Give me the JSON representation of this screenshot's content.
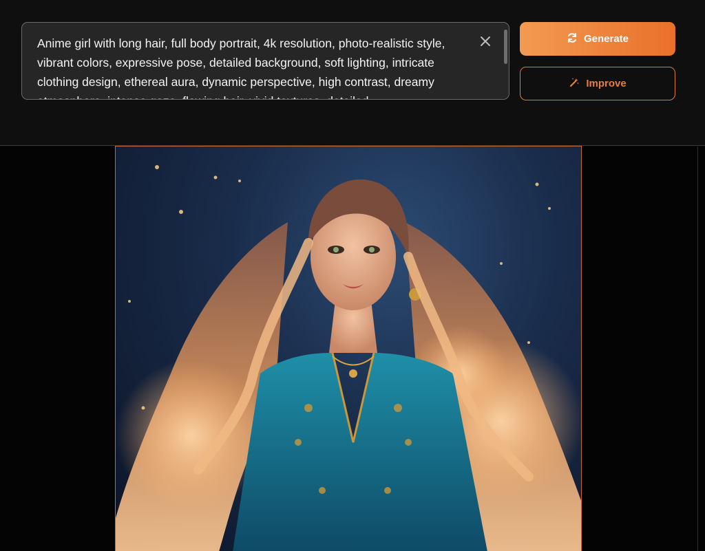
{
  "prompt": {
    "text": "Anime girl with long hair, full body portrait, 4k resolution, photo-realistic style, vibrant colors, expressive pose, detailed background, soft lighting, intricate clothing design, ethereal aura, dynamic perspective, high contrast, dreamy atmosphere, intense gaze, flowing hair, vivid textures, detailed",
    "clear_icon": "close-icon"
  },
  "actions": {
    "generate_label": "Generate",
    "generate_icon": "refresh-icon",
    "improve_label": "Improve",
    "improve_icon": "magic-wand-icon"
  },
  "colors": {
    "accent": "#ec7a33",
    "accent_light": "#f39a52",
    "background": "#0f0f0f"
  },
  "generated_image": {
    "alt": "Generated anime-style portrait of a woman with long flowing hair in a teal dress"
  }
}
